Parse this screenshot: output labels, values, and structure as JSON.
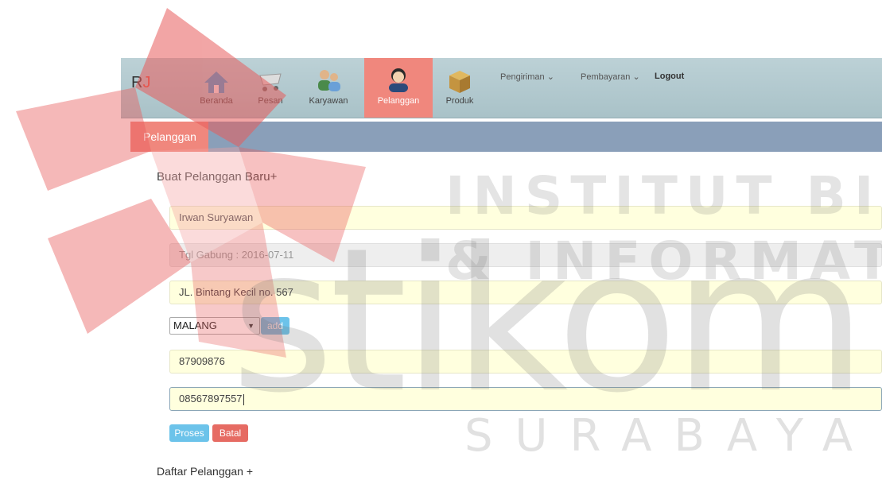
{
  "watermark": {
    "line1": "INSTITUT BISNIS",
    "line2": "& INFORMATIKA",
    "line3": "stikom",
    "line4": "SURABAYA"
  },
  "brand": {
    "r": "R",
    "j": "J"
  },
  "nav": {
    "items": [
      {
        "label": "Beranda",
        "icon": "house-icon"
      },
      {
        "label": "Pesan",
        "icon": "cart-icon"
      },
      {
        "label": "Karyawan",
        "icon": "people-icon"
      },
      {
        "label": "Pelanggan",
        "icon": "customer-icon",
        "active": true
      },
      {
        "label": "Produk",
        "icon": "box-icon"
      }
    ],
    "menus": [
      {
        "label": "Pengiriman",
        "caret": "⌄"
      },
      {
        "label": "Pembayaran",
        "caret": "⌄"
      },
      {
        "label": "Logout"
      }
    ]
  },
  "breadcrumb": {
    "label": "Pelanggan"
  },
  "form": {
    "title": "Buat Pelanggan Baru+",
    "nama": "Irwan Suryawan",
    "tgl_gabung": "Tgl Gabung : 2016-07-11",
    "alamat": "JL. Bintang Kecil no. 567",
    "kota": "MALANG",
    "add_label": "add",
    "telepon": "87909876",
    "hp": "08567897557",
    "proses_label": "Proses",
    "batal_label": "Batal"
  },
  "list": {
    "title": "Daftar Pelanggan +"
  },
  "colors": {
    "accent": "#f0877d",
    "navbar": "#b3cbd1",
    "breadcrumb": "#8a9fb9",
    "field": "#ffffde",
    "btn_blue": "#6cc3ea",
    "btn_red": "#e66b63"
  }
}
